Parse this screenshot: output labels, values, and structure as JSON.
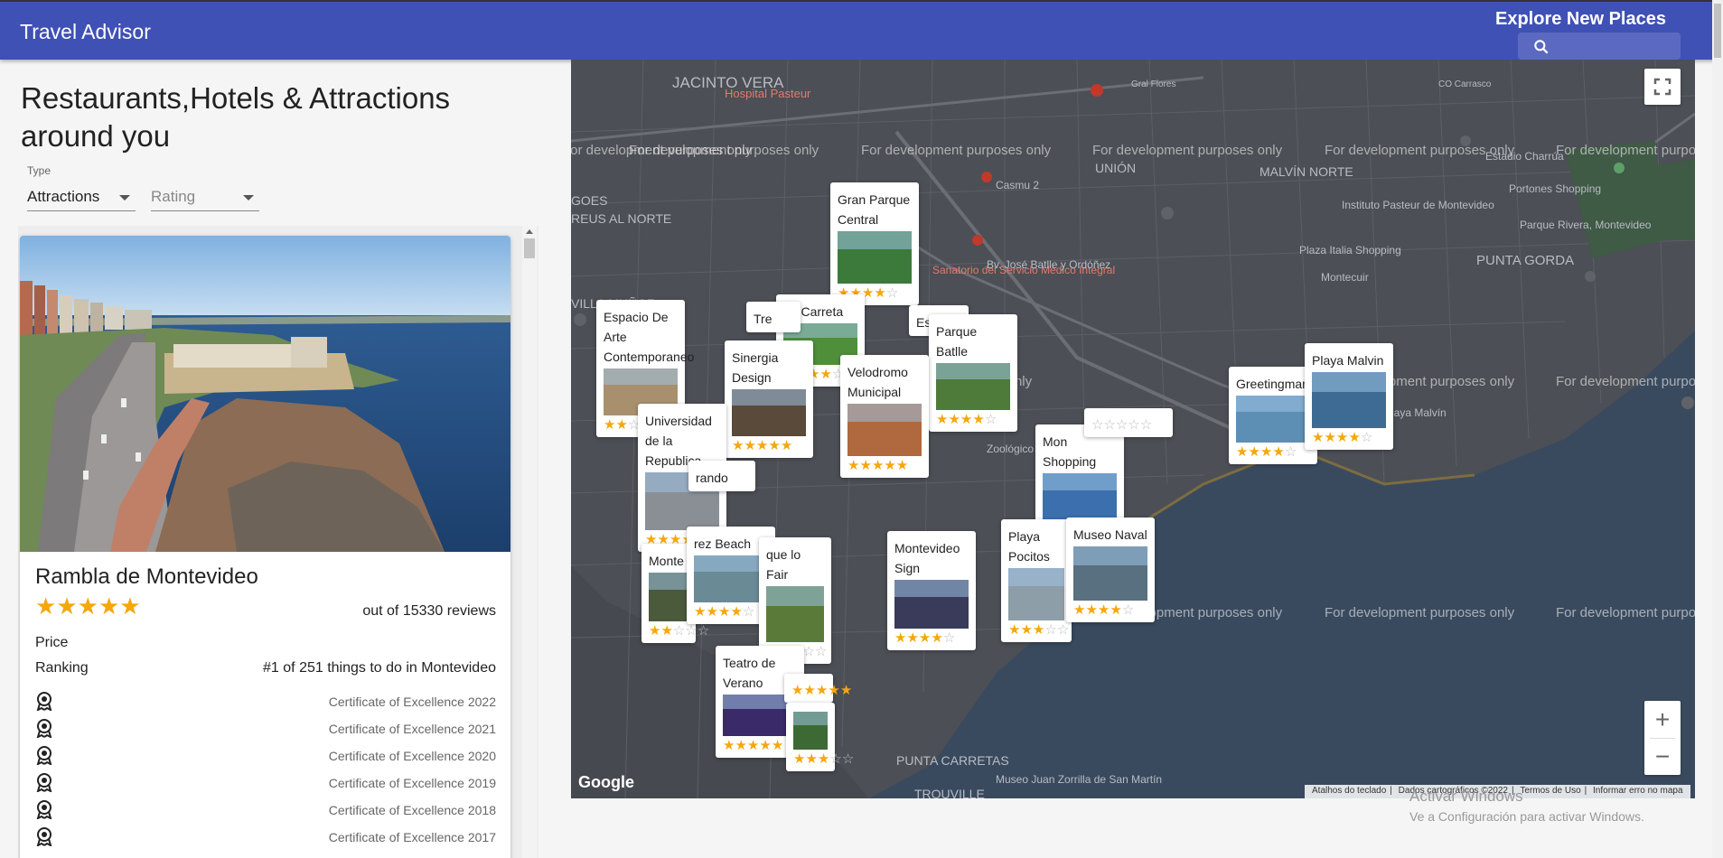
{
  "app": {
    "title": "Travel Advisor",
    "explore_label": "Explore New Places",
    "search_placeholder": ""
  },
  "heading": "Restaurants,Hotels & Attractions around you",
  "filters": {
    "type_label": "Type",
    "type_value": "Attractions",
    "rating_placeholder": "Rating"
  },
  "card": {
    "name": "Rambla de Montevideo",
    "rating": 5,
    "reviews_text": "out of 15330 reviews",
    "price_label": "Price",
    "ranking_label": "Ranking",
    "ranking_value": "#1 of 251 things to do in Montevideo",
    "certificates": [
      "Certificate of Excellence 2022",
      "Certificate of Excellence 2021",
      "Certificate of Excellence 2020",
      "Certificate of Excellence 2019",
      "Certificate of Excellence 2018",
      "Certificate of Excellence 2017"
    ]
  },
  "map": {
    "watermark": "For development purposes only",
    "labels": [
      "JACINTO VERA",
      "GOES",
      "REUS AL NORTE",
      "VILLA MUÑOZ",
      "UNIÓN",
      "MALVÍN NORTE",
      "PUNTA GORDA",
      "TROUVILLE",
      "PUNTA CARRETAS",
      "Hospital Pasteur",
      "Estadio Charrúa",
      "Portones Shopping",
      "Parque Rivera, Montevideo",
      "Plaza Italia Shopping",
      "Instituto Pasteur de Montevideo",
      "Montecuir",
      "Sanatorio del Servicio Médico Integral",
      "Casmu 2",
      "Bv. José Batlle y Ordóñez",
      "Zoológico",
      "Playa Malvín",
      "Museo Juan Zorrilla de San Martín",
      "CO Carrasco",
      "Gral Flores"
    ],
    "google_label": "Google",
    "attribution": [
      "Atalhos do teclado",
      "Dados cartográficos ©2022",
      "Termos de Uso",
      "Informar erro no mapa"
    ],
    "zoom_in": "+",
    "zoom_out": "−",
    "pins": [
      {
        "name": "Gran Parque Central",
        "rating": 4
      },
      {
        "name": "La Carreta",
        "rating": 4
      },
      {
        "name": "Tre",
        "rating": 0
      },
      {
        "name": "Est Cer",
        "rating": 0
      },
      {
        "name": "Espacio De Arte Contemporaneo",
        "rating": 2
      },
      {
        "name": "Parque Batlle",
        "rating": 4
      },
      {
        "name": "Sinergia Design",
        "rating": 5
      },
      {
        "name": "Velodromo Municipal",
        "rating": 5
      },
      {
        "name": "Universidad de la Republica",
        "rating": 4
      },
      {
        "name": "rando",
        "rating": 0
      },
      {
        "name": "Mon Shopping",
        "rating": 0
      },
      {
        "name": "",
        "rating": 0
      },
      {
        "name": "Greetingman",
        "rating": 4
      },
      {
        "name": "Playa Malvin",
        "rating": 4
      },
      {
        "name": "Monte",
        "rating": 2
      },
      {
        "name": "rez Beach",
        "rating": 4
      },
      {
        "name": "que lo Fair",
        "rating": 3
      },
      {
        "name": "Montevideo Sign",
        "rating": 4
      },
      {
        "name": "Playa Pocitos",
        "rating": 3
      },
      {
        "name": "Museo Naval",
        "rating": 4
      },
      {
        "name": "Teatro de Verano",
        "rating": 5
      },
      {
        "name": "",
        "rating": 5
      },
      {
        "name": "",
        "rating": 3
      }
    ]
  },
  "windows": {
    "line1": "Activar Windows",
    "line2": "Ve a Configuración para activar Windows."
  }
}
